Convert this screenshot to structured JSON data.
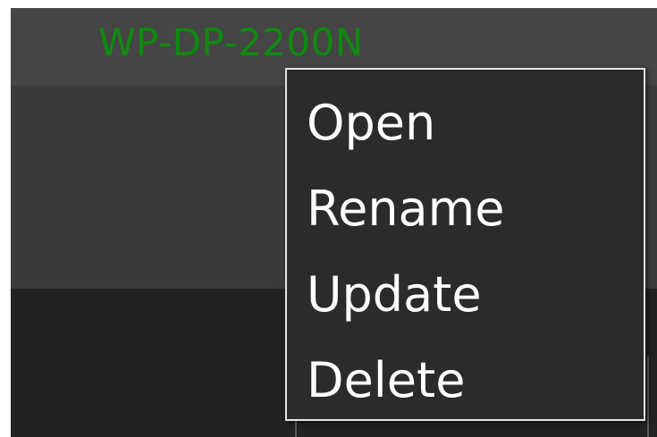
{
  "device": {
    "name": "WP-DP-2200N",
    "name_color": "#0f8a0f"
  },
  "context_menu": {
    "items": [
      {
        "label": "Open"
      },
      {
        "label": "Rename"
      },
      {
        "label": "Update"
      },
      {
        "label": "Delete"
      }
    ]
  },
  "colors": {
    "menu_background": "#2b2b2b",
    "menu_border": "#e6e6e6",
    "menu_text": "#ffffff",
    "row_background": "#454545"
  }
}
